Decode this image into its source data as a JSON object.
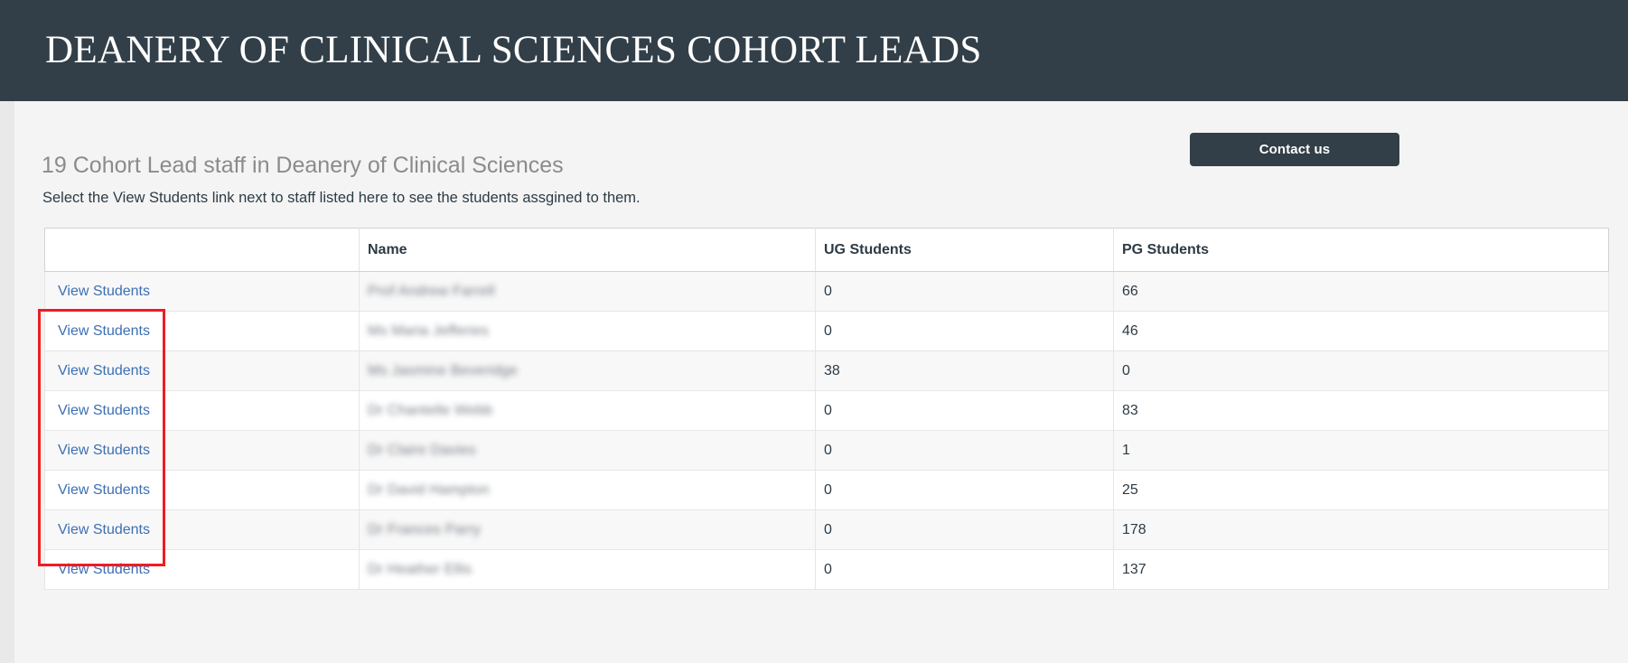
{
  "masthead": {
    "title": "DEANERY OF CLINICAL SCIENCES COHORT LEADS",
    "background_color": "#323f48",
    "text_color": "#ffffff"
  },
  "toolbar": {
    "contact_label": "Contact us"
  },
  "main": {
    "heading": "19 Cohort Lead staff in Deanery of Clinical Sciences",
    "subtext": "Select the View Students link next to staff listed here to see the students assgined to them.",
    "accent_color": "#3c6fb5",
    "annotation_color": "#ee1c22"
  },
  "table": {
    "columns": [
      "",
      "Name",
      "UG Students",
      "PG Students"
    ],
    "link_label": "View Students",
    "rows": [
      {
        "link": "View Students",
        "name": "Prof Andrew Farrell",
        "ug": "0",
        "pg": "66"
      },
      {
        "link": "View Students",
        "name": "Ms Maria Jefferies",
        "ug": "0",
        "pg": "46"
      },
      {
        "link": "View Students",
        "name": "Ms Jasmine Beveridge",
        "ug": "38",
        "pg": "0"
      },
      {
        "link": "View Students",
        "name": "Dr Chantelle Webb",
        "ug": "0",
        "pg": "83"
      },
      {
        "link": "View Students",
        "name": "Dr Claire Davies",
        "ug": "0",
        "pg": "1"
      },
      {
        "link": "View Students",
        "name": "Dr David Hampton",
        "ug": "0",
        "pg": "25"
      },
      {
        "link": "View Students",
        "name": "Dr Frances Parry",
        "ug": "0",
        "pg": "178"
      },
      {
        "link": "View Students",
        "name": "Dr Heather Ellis",
        "ug": "0",
        "pg": "137"
      }
    ]
  }
}
